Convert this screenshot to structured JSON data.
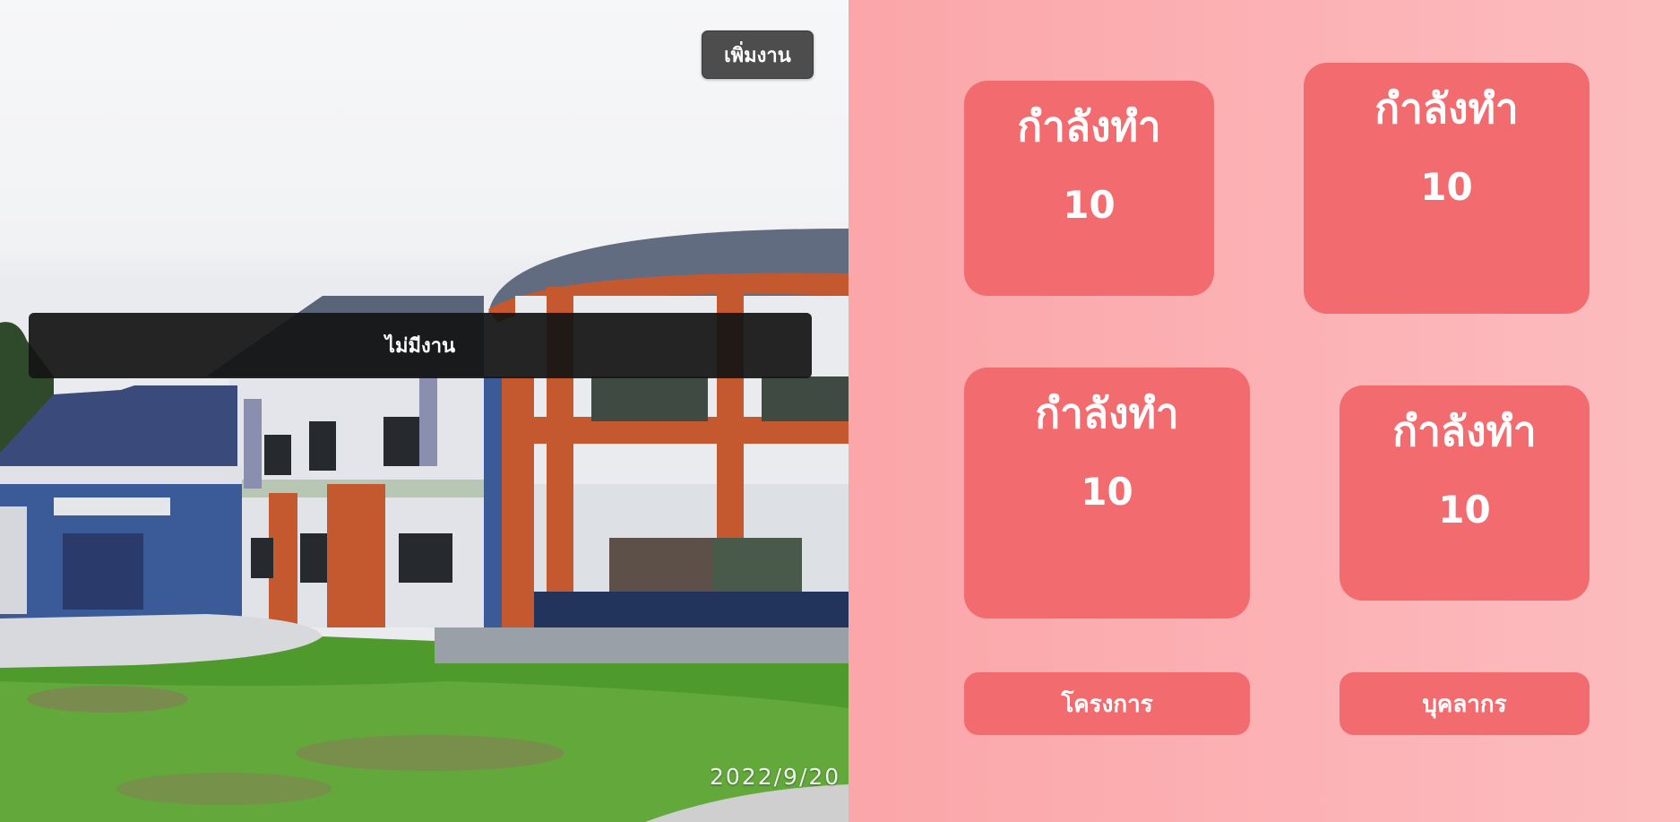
{
  "photo": {
    "date_stamp": "2022/9/20"
  },
  "toolbar": {
    "add_task_label": "เพิ่มงาน"
  },
  "tasks": {
    "empty_label": "ไม่มีงาน"
  },
  "cards": [
    {
      "label": "กำลังทำ",
      "value": "10"
    },
    {
      "label": "กำลังทำ",
      "value": "10"
    },
    {
      "label": "กำลังทำ",
      "value": "10"
    },
    {
      "label": "กำลังทำ",
      "value": "10"
    }
  ],
  "nav": {
    "projects_label": "โครงการ",
    "personnel_label": "บุคลากร"
  },
  "colors": {
    "card": "#f26b6e",
    "panel_left": "#fba6a9",
    "panel_right": "#fcbcbe"
  }
}
